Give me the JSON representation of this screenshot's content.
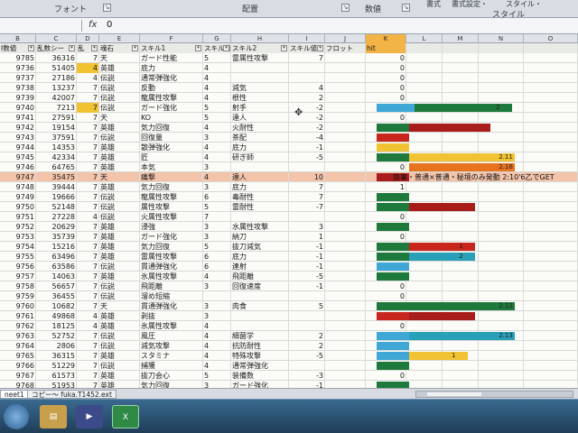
{
  "ribbon": {
    "groups": [
      "フォント",
      "配置",
      "数値",
      "スタイル"
    ],
    "buttons": [
      "書式",
      "書式設定・",
      "スタイル・"
    ]
  },
  "formula_bar": {
    "fx": "fx",
    "value": "0"
  },
  "columns": [
    "B",
    "C",
    "D",
    "E",
    "F",
    "G",
    "H",
    "I",
    "J",
    "K",
    "L",
    "M",
    "N",
    "O"
  ],
  "selected_column": "K",
  "headers": [
    "I数値",
    "乱数シー",
    "乱",
    "魂石",
    "スキル1",
    "スキル値",
    "スキル2",
    "スキル値",
    "フロット",
    "hit",
    "",
    "",
    "",
    ""
  ],
  "rows": [
    {
      "b": "9785",
      "c": "36316",
      "d": "7",
      "e": "天",
      "f": "ガード性能",
      "g": "5",
      "h": "雷属性攻撃",
      "i": "7",
      "j": "",
      "k": "0"
    },
    {
      "b": "9736",
      "c": "51405",
      "d": "4",
      "e": "英雄",
      "f": "底力",
      "g": "4",
      "h": "",
      "i": "",
      "j": "",
      "k": "0",
      "dmark": true
    },
    {
      "b": "9737",
      "c": "27186",
      "d": "4",
      "e": "伝説",
      "f": "通常弾強化",
      "g": "4",
      "h": "",
      "i": "",
      "j": "",
      "k": "0"
    },
    {
      "b": "9738",
      "c": "13237",
      "d": "7",
      "e": "伝説",
      "f": "反動",
      "g": "4",
      "h": "減気",
      "i": "4",
      "j": "",
      "k": "0"
    },
    {
      "b": "9739",
      "c": "42007",
      "d": "7",
      "e": "伝説",
      "f": "龍属性攻撃",
      "g": "4",
      "h": "根性",
      "i": "2",
      "j": "",
      "k": "0"
    },
    {
      "b": "9740",
      "c": "7213",
      "d": "7",
      "e": "伝説",
      "f": "ガード強化",
      "g": "5",
      "h": "射手",
      "i": "-2",
      "j": "",
      "k": "0",
      "dmark": true
    },
    {
      "b": "9741",
      "c": "27591",
      "d": "7",
      "e": "天",
      "f": "KO",
      "g": "5",
      "h": "達人",
      "i": "-2",
      "j": "",
      "k": "0"
    },
    {
      "b": "9742",
      "c": "19154",
      "d": "7",
      "e": "英雄",
      "f": "気力回復",
      "g": "4",
      "h": "火耐性",
      "i": "-2",
      "j": "",
      "k": "1"
    },
    {
      "b": "9743",
      "c": "37591",
      "d": "7",
      "e": "伝説",
      "f": "回復量",
      "g": "3",
      "h": "茶配",
      "i": "-4",
      "j": "",
      "k": "0"
    },
    {
      "b": "9744",
      "c": "14353",
      "d": "7",
      "e": "英雄",
      "f": "散弾強化",
      "g": "4",
      "h": "底力",
      "i": "-1",
      "j": "",
      "k": "0"
    },
    {
      "b": "9745",
      "c": "42334",
      "d": "7",
      "e": "英雄",
      "f": "匠",
      "g": "4",
      "h": "研ぎ師",
      "i": "-5",
      "j": "",
      "k": "0"
    },
    {
      "b": "9746",
      "c": "64765",
      "d": "7",
      "e": "英雄",
      "f": "本気",
      "g": "3",
      "h": "",
      "i": "",
      "j": "",
      "k": "0"
    },
    {
      "b": "9747",
      "c": "35475",
      "d": "7",
      "e": "天",
      "f": "痛撃",
      "g": "4",
      "h": "達人",
      "i": "10",
      "j": "",
      "k": "0",
      "hl": true
    },
    {
      "b": "9748",
      "c": "39444",
      "d": "7",
      "e": "英雄",
      "f": "気力回復",
      "g": "3",
      "h": "底力",
      "i": "7",
      "j": "",
      "k": "1"
    },
    {
      "b": "9749",
      "c": "19666",
      "d": "7",
      "e": "伝説",
      "f": "龍属性攻撃",
      "g": "6",
      "h": "毒耐性",
      "i": "7",
      "j": "",
      "k": "0"
    },
    {
      "b": "9750",
      "c": "52148",
      "d": "7",
      "e": "伝説",
      "f": "属性攻撃",
      "g": "5",
      "h": "雷耐性",
      "i": "-7",
      "j": "",
      "k": "0"
    },
    {
      "b": "9751",
      "c": "27228",
      "d": "4",
      "e": "伝説",
      "f": "火属性攻撃",
      "g": "7",
      "h": "",
      "i": "",
      "j": "",
      "k": "0"
    },
    {
      "b": "9752",
      "c": "20629",
      "d": "7",
      "e": "英雄",
      "f": "浸強",
      "g": "3",
      "h": "水属性攻撃",
      "i": "3",
      "j": "",
      "k": "1"
    },
    {
      "b": "9753",
      "c": "35739",
      "d": "7",
      "e": "英雄",
      "f": "ガード強化",
      "g": "3",
      "h": "納刀",
      "i": "1",
      "j": "",
      "k": "0"
    },
    {
      "b": "9754",
      "c": "15216",
      "d": "7",
      "e": "英雄",
      "f": "気力回復",
      "g": "5",
      "h": "抜刀減気",
      "i": "-1",
      "j": "",
      "k": "0"
    },
    {
      "b": "9755",
      "c": "63496",
      "d": "7",
      "e": "英雄",
      "f": "雷属性攻撃",
      "g": "6",
      "h": "底力",
      "i": "-1",
      "j": "",
      "k": "0"
    },
    {
      "b": "9756",
      "c": "63586",
      "d": "7",
      "e": "伝説",
      "f": "貫通弾強化",
      "g": "6",
      "h": "連射",
      "i": "-1",
      "j": "",
      "k": "0"
    },
    {
      "b": "9757",
      "c": "14063",
      "d": "7",
      "e": "英雄",
      "f": "氷属性攻撃",
      "g": "4",
      "h": "飛距離",
      "i": "-5",
      "j": "",
      "k": "0"
    },
    {
      "b": "9758",
      "c": "56657",
      "d": "7",
      "e": "伝説",
      "f": "飛距離",
      "g": "3",
      "h": "回復速度",
      "i": "-1",
      "j": "",
      "k": "0"
    },
    {
      "b": "9759",
      "c": "36455",
      "d": "7",
      "e": "伝説",
      "f": "溜め短縮",
      "g": "",
      "h": "",
      "i": "",
      "j": "",
      "k": "0"
    },
    {
      "b": "9760",
      "c": "10682",
      "d": "7",
      "e": "天",
      "f": "貫通弾強化",
      "g": "3",
      "h": "肉食",
      "i": "5",
      "j": "",
      "k": "0"
    },
    {
      "b": "9761",
      "c": "49868",
      "d": "4",
      "e": "英雄",
      "f": "剥抜",
      "g": "3",
      "h": "",
      "i": "",
      "j": "",
      "k": "1"
    },
    {
      "b": "9762",
      "c": "18125",
      "d": "4",
      "e": "英雄",
      "f": "氷属性攻撃",
      "g": "4",
      "h": "",
      "i": "",
      "j": "",
      "k": "0"
    },
    {
      "b": "9763",
      "c": "52752",
      "d": "7",
      "e": "伝説",
      "f": "風圧",
      "g": "4",
      "h": "細菌学",
      "i": "2",
      "j": "",
      "k": "0"
    },
    {
      "b": "9764",
      "c": "2806",
      "d": "7",
      "e": "伝説",
      "f": "減気攻撃",
      "g": "4",
      "h": "抗防耐性",
      "i": "2",
      "j": "",
      "k": "0"
    },
    {
      "b": "9765",
      "c": "36315",
      "d": "7",
      "e": "英雄",
      "f": "スタミナ",
      "g": "4",
      "h": "特殊攻撃",
      "i": "-5",
      "j": "",
      "k": "0"
    },
    {
      "b": "9766",
      "c": "51229",
      "d": "7",
      "e": "伝説",
      "f": "捕獲",
      "g": "4",
      "h": "通常弾強化",
      "i": "",
      "j": "",
      "k": "0"
    },
    {
      "b": "9767",
      "c": "61573",
      "d": "7",
      "e": "英雄",
      "f": "抜刀会心",
      "g": "5",
      "h": "装備数",
      "i": "-3",
      "j": "",
      "k": "0"
    },
    {
      "b": "9768",
      "c": "51953",
      "d": "7",
      "e": "英雄",
      "f": "気力回復",
      "g": "3",
      "h": "ガード強化",
      "i": "-1",
      "j": "",
      "k": "0"
    },
    {
      "b": "9769",
      "c": "58271",
      "d": "7",
      "e": "英雄",
      "f": "号令",
      "g": "4",
      "h": "",
      "i": "",
      "j": "",
      "k": "0"
    }
  ],
  "bars": [
    {
      "row": 5,
      "start": 0.0,
      "len": 0.26,
      "color": "#3fa7d6"
    },
    {
      "row": 5,
      "start": 0.26,
      "len": 0.66,
      "color": "#1e7a3c",
      "label": "2"
    },
    {
      "row": 7,
      "start": 0.0,
      "len": 0.22,
      "color": "#1e7a3c"
    },
    {
      "row": 7,
      "start": 0.22,
      "len": 0.55,
      "color": "#a81c1c"
    },
    {
      "row": 8,
      "start": 0.0,
      "len": 0.22,
      "color": "#c8261d"
    },
    {
      "row": 9,
      "start": 0.0,
      "len": 0.22,
      "color": "#f1c232"
    },
    {
      "row": 10,
      "start": 0.0,
      "len": 0.22,
      "color": "#1e7a3c"
    },
    {
      "row": 10,
      "start": 0.22,
      "len": 0.72,
      "color": "#f1c232",
      "label": "2.11"
    },
    {
      "row": 11,
      "start": 0.22,
      "len": 0.72,
      "color": "#e8731f",
      "label": "2.16"
    },
    {
      "row": 12,
      "start": 0.0,
      "len": 0.22,
      "color": "#a81c1c"
    },
    {
      "row": 14,
      "start": 0.0,
      "len": 0.22,
      "color": "#1e7a3c"
    },
    {
      "row": 15,
      "start": 0.0,
      "len": 0.22,
      "color": "#1e7a3c"
    },
    {
      "row": 15,
      "start": 0.22,
      "len": 0.45,
      "color": "#a81c1c"
    },
    {
      "row": 17,
      "start": 0.0,
      "len": 0.22,
      "color": "#1e7a3c"
    },
    {
      "row": 19,
      "start": 0.0,
      "len": 0.22,
      "color": "#1e7a3c"
    },
    {
      "row": 19,
      "start": 0.22,
      "len": 0.45,
      "color": "#c8261d",
      "label": "1"
    },
    {
      "row": 20,
      "start": 0.0,
      "len": 0.22,
      "color": "#1e7a3c"
    },
    {
      "row": 20,
      "start": 0.22,
      "len": 0.45,
      "color": "#2a9fb8",
      "label": "2"
    },
    {
      "row": 21,
      "start": 0.0,
      "len": 0.22,
      "color": "#3fa7d6"
    },
    {
      "row": 22,
      "start": 0.0,
      "len": 0.22,
      "color": "#1e7a3c"
    },
    {
      "row": 25,
      "start": 0.0,
      "len": 0.22,
      "color": "#1e7a3c"
    },
    {
      "row": 25,
      "start": 0.22,
      "len": 0.72,
      "color": "#1e7a3c",
      "label": "2.12"
    },
    {
      "row": 26,
      "start": 0.0,
      "len": 0.22,
      "color": "#c8261d"
    },
    {
      "row": 26,
      "start": 0.22,
      "len": 0.45,
      "color": "#a81c1c"
    },
    {
      "row": 28,
      "start": 0.0,
      "len": 0.22,
      "color": "#3fa7d6"
    },
    {
      "row": 28,
      "start": 0.22,
      "len": 0.72,
      "color": "#2a9fb8",
      "label": "2.13"
    },
    {
      "row": 29,
      "start": 0.0,
      "len": 0.22,
      "color": "#3fa7d6"
    },
    {
      "row": 30,
      "start": 0.0,
      "len": 0.22,
      "color": "#3fa7d6"
    },
    {
      "row": 30,
      "start": 0.22,
      "len": 0.4,
      "color": "#f1c232",
      "label": "1"
    },
    {
      "row": 31,
      "start": 0.0,
      "len": 0.22,
      "color": "#1e7a3c"
    },
    {
      "row": 33,
      "start": 0.0,
      "len": 0.22,
      "color": "#1e7a3c"
    }
  ],
  "note": {
    "row": 12,
    "text": "良事・普通×普通・秘境のみ発動 2:10'6乙でGET"
  },
  "sheet_tabs": [
    "neet1",
    "コピー～ fuka.T1452.ext"
  ],
  "taskbar": {
    "start": "start",
    "explorer": "explorer",
    "media": "media",
    "excel": "excel"
  }
}
